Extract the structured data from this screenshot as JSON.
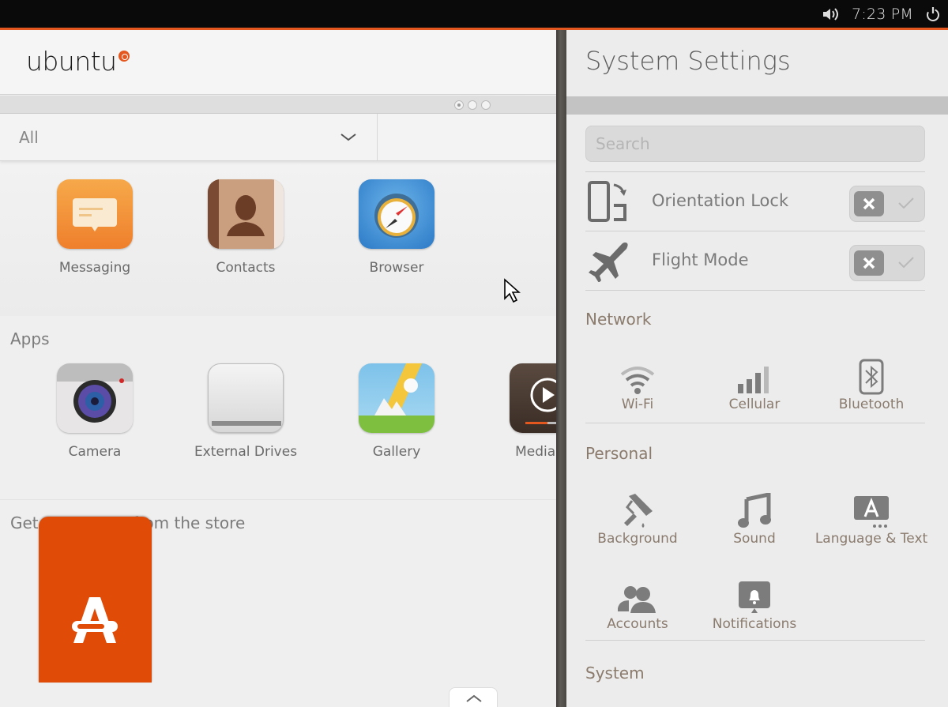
{
  "top_panel": {
    "clock": "7:23 PM",
    "indicators": [
      "volume-icon",
      "power-icon"
    ]
  },
  "dash": {
    "logo": "ubuntu",
    "page_dots": {
      "count": 3,
      "active": 0
    },
    "filter": {
      "selected": "All"
    },
    "favorites": [
      {
        "name": "Messaging",
        "icon": "messaging-icon"
      },
      {
        "name": "Contacts",
        "icon": "contacts-icon"
      },
      {
        "name": "Browser",
        "icon": "browser-icon"
      }
    ],
    "apps_section": {
      "title": "Apps",
      "items": [
        {
          "name": "Camera",
          "icon": "camera-icon"
        },
        {
          "name": "External Drives",
          "icon": "external-drives-icon"
        },
        {
          "name": "Gallery",
          "icon": "gallery-icon"
        },
        {
          "name": "Media Pla",
          "icon": "media-player-icon"
        }
      ]
    },
    "store_section": {
      "title": "Get more apps from the store",
      "icon": "ubuntu-store-icon"
    }
  },
  "settings": {
    "title": "System Settings",
    "search_placeholder": "Search",
    "toggles": [
      {
        "label": "Orientation Lock",
        "icon": "orientation-lock-icon",
        "on": false
      },
      {
        "label": "Flight Mode",
        "icon": "airplane-icon",
        "on": false
      }
    ],
    "groups": {
      "network": {
        "title": "Network",
        "items": [
          {
            "label": "Wi-Fi",
            "icon": "wifi-icon"
          },
          {
            "label": "Cellular",
            "icon": "cellular-icon"
          },
          {
            "label": "Bluetooth",
            "icon": "bluetooth-icon"
          }
        ]
      },
      "personal": {
        "title": "Personal",
        "items": [
          {
            "label": "Background",
            "icon": "paint-roller-icon"
          },
          {
            "label": "Sound",
            "icon": "music-note-icon"
          },
          {
            "label": "Language & Text",
            "icon": "language-icon"
          },
          {
            "label": "Accounts",
            "icon": "accounts-icon"
          },
          {
            "label": "Notifications",
            "icon": "notification-bell-icon"
          }
        ]
      },
      "system": {
        "title": "System"
      }
    }
  },
  "colors": {
    "accent": "#e4571e",
    "store_tile": "#e04b07"
  }
}
